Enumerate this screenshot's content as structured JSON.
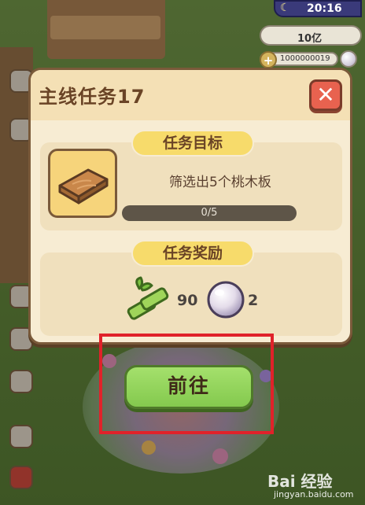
{
  "hud": {
    "time": "20:16",
    "money": "10亿",
    "pearl_count": "1000000019"
  },
  "dialog": {
    "title": "主线任务17",
    "close_label": "✕",
    "goal_section_label": "任务目标",
    "task_description": "筛选出5个桃木板",
    "progress_text": "0/5",
    "progress_fraction": 0,
    "reward_section_label": "任务奖励",
    "rewards": [
      {
        "icon": "bamboo-icon",
        "count": "90"
      },
      {
        "icon": "pearl-icon",
        "count": "2"
      }
    ]
  },
  "go_button_label": "前往",
  "watermark": {
    "logo": "Bai 经验",
    "url": "jingyan.baidu.com"
  },
  "colors": {
    "go_button": "#8fd15a",
    "close_button": "#e8624f",
    "highlight_box": "#e0222a",
    "section_pill": "#f7db6b"
  }
}
